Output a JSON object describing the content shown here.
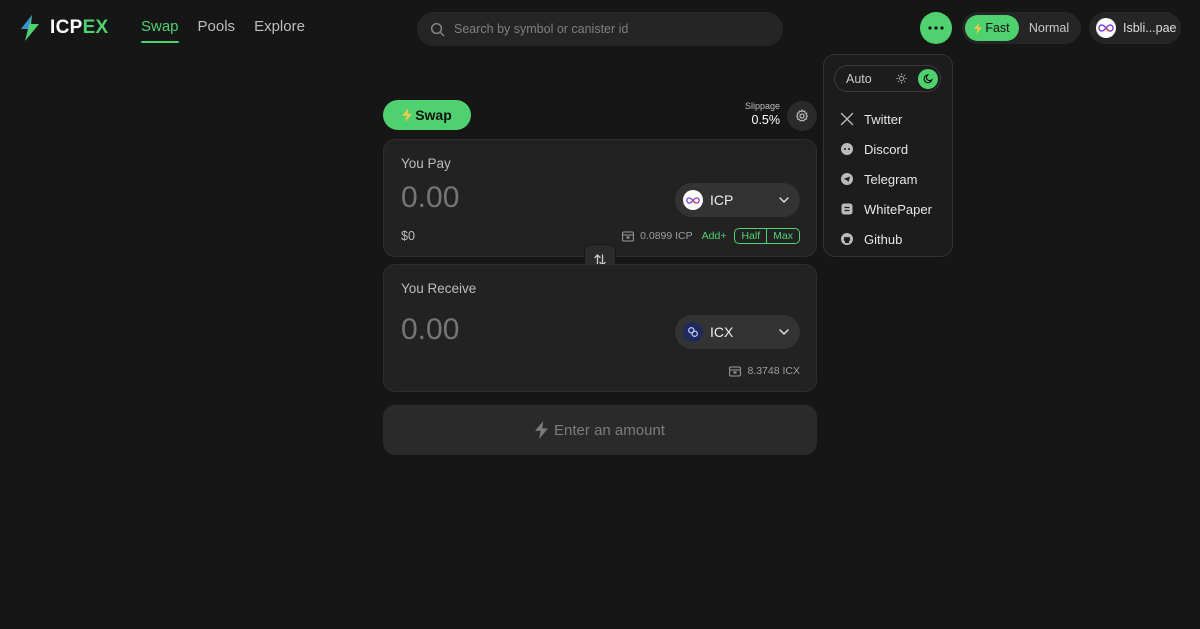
{
  "header": {
    "logo": {
      "prefix": "ICP",
      "suffix": "EX"
    },
    "nav": [
      {
        "label": "Swap",
        "active": true
      },
      {
        "label": "Pools",
        "active": false
      },
      {
        "label": "Explore",
        "active": false
      }
    ],
    "search": {
      "placeholder": "Search by symbol or canister id",
      "icon": "search-icon"
    },
    "more_icon": "more-dots-icon",
    "speed": {
      "fast_label": "Fast",
      "normal_label": "Normal",
      "selected": "Fast"
    },
    "account": {
      "label": "Isbli...pae"
    }
  },
  "dropdown": {
    "theme": {
      "auto_label": "Auto",
      "selected": "dark"
    },
    "items": [
      {
        "label": "Twitter",
        "icon": "x-twitter-icon"
      },
      {
        "label": "Discord",
        "icon": "discord-icon"
      },
      {
        "label": "Telegram",
        "icon": "telegram-icon"
      },
      {
        "label": "WhitePaper",
        "icon": "document-icon"
      },
      {
        "label": "Github",
        "icon": "github-icon"
      }
    ]
  },
  "swap": {
    "tab_label": "Swap",
    "slippage": {
      "label": "Slippage",
      "value": "0.5%"
    },
    "pay": {
      "label": "You Pay",
      "amount_placeholder": "0.00",
      "token": "ICP",
      "usd": "$0",
      "balance": "0.0899 ICP",
      "add_label": "Add+",
      "half_label": "Half",
      "max_label": "Max"
    },
    "receive": {
      "label": "You Receive",
      "amount_placeholder": "0.00",
      "token": "ICX",
      "balance": "8.3748 ICX"
    },
    "action_label": "Enter an amount"
  },
  "colors": {
    "accent": "#4fd16f",
    "background": "#161616",
    "card": "#222222"
  }
}
